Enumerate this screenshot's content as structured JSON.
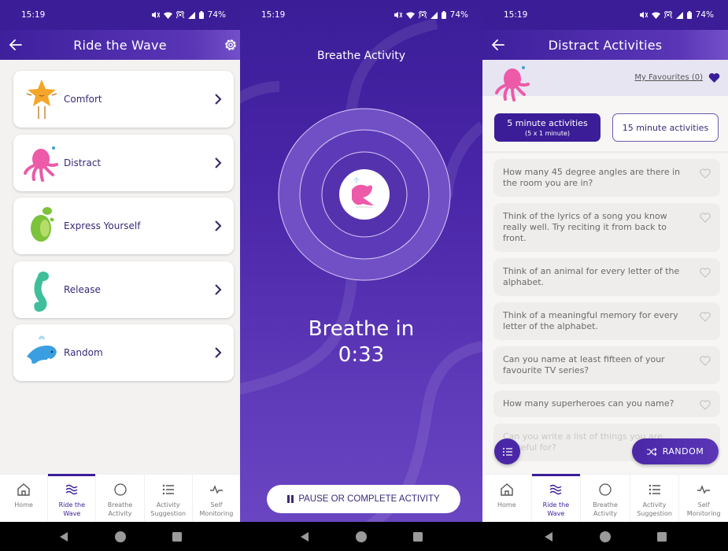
{
  "status": {
    "time": "15:19",
    "battery": "74%"
  },
  "screens": {
    "ride_the_wave": {
      "title": "Ride the Wave",
      "categories": [
        {
          "label": "Comfort",
          "mascot": "star-mascot",
          "color": "#f4a62a"
        },
        {
          "label": "Distract",
          "mascot": "octopus-mascot",
          "color": "#ec5aa8"
        },
        {
          "label": "Express Yourself",
          "mascot": "turtle-mascot",
          "color": "#7cc23a"
        },
        {
          "label": "Release",
          "mascot": "seahorse-mascot",
          "color": "#3fbf99"
        },
        {
          "label": "Random",
          "mascot": "shark-mascot",
          "color": "#3a9ee0"
        }
      ]
    },
    "breathe": {
      "title": "Breathe Activity",
      "instruction": "Breathe in",
      "timer": "0:33",
      "pause_button": "PAUSE OR COMPLETE ACTIVITY"
    },
    "distract": {
      "title": "Distract Activities",
      "favourites_link": "My Favourites (0)",
      "tabs": [
        {
          "label": "5 minute activities",
          "sublabel": "(5 x 1 minute)",
          "active": true
        },
        {
          "label": "15 minute activities",
          "sublabel": "",
          "active": false
        }
      ],
      "activities": [
        "How many 45 degree angles are there in the room you are in?",
        "Think of the lyrics of a song you know really well. Try reciting it from back to front.",
        "Think of an animal for every letter of the alphabet.",
        "Think of a meaningful memory for every letter of the alphabet.",
        "Can you name at least fifteen of your favourite TV series?",
        "How many superheroes can you name?",
        "Can you write a list of things you are grateful for?"
      ],
      "random_button": "RANDOM"
    }
  },
  "bottom_nav": [
    {
      "label": "Home",
      "icon": "home-icon"
    },
    {
      "label": "Ride the\nWave",
      "icon": "waves-icon",
      "active": true
    },
    {
      "label": "Breathe\nActivity",
      "icon": "circle-icon"
    },
    {
      "label": "Activity\nSuggestion",
      "icon": "list-icon"
    },
    {
      "label": "Self\nMonitoring",
      "icon": "pulse-icon"
    }
  ],
  "colors": {
    "primary": "#3b1d98",
    "accent_light": "#6c48c4",
    "card_bg": "#ffffff",
    "text_dark": "#3a2a78"
  }
}
